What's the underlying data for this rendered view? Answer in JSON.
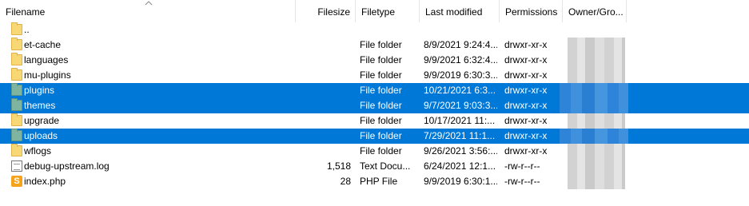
{
  "columns": {
    "filename": "Filename",
    "filesize": "Filesize",
    "filetype": "Filetype",
    "last_modified": "Last modified",
    "permissions": "Permissions",
    "owner_group": "Owner/Gro..."
  },
  "files": [
    {
      "name": "..",
      "size": "",
      "type": "",
      "modified": "",
      "perms": "",
      "icon": "folder-icon",
      "selected": false,
      "owner_blurred": false
    },
    {
      "name": "et-cache",
      "size": "",
      "type": "File folder",
      "modified": "8/9/2021 9:24:4...",
      "perms": "drwxr-xr-x",
      "icon": "folder-icon",
      "selected": false,
      "owner_blurred": true
    },
    {
      "name": "languages",
      "size": "",
      "type": "File folder",
      "modified": "9/9/2021 6:32:4...",
      "perms": "drwxr-xr-x",
      "icon": "folder-icon",
      "selected": false,
      "owner_blurred": true
    },
    {
      "name": "mu-plugins",
      "size": "",
      "type": "File folder",
      "modified": "9/9/2019 6:30:3...",
      "perms": "drwxr-xr-x",
      "icon": "folder-icon",
      "selected": false,
      "owner_blurred": true
    },
    {
      "name": "plugins",
      "size": "",
      "type": "File folder",
      "modified": "10/21/2021 6:3...",
      "perms": "drwxr-xr-x",
      "icon": "folder-icon",
      "selected": true,
      "owner_blurred": true
    },
    {
      "name": "themes",
      "size": "",
      "type": "File folder",
      "modified": "9/7/2021 9:03:3...",
      "perms": "drwxr-xr-x",
      "icon": "folder-icon",
      "selected": true,
      "owner_blurred": true
    },
    {
      "name": "upgrade",
      "size": "",
      "type": "File folder",
      "modified": "10/17/2021 11:...",
      "perms": "drwxr-xr-x",
      "icon": "folder-icon",
      "selected": false,
      "owner_blurred": true
    },
    {
      "name": "uploads",
      "size": "",
      "type": "File folder",
      "modified": "7/29/2021 11:1...",
      "perms": "drwxr-xr-x",
      "icon": "folder-icon",
      "selected": true,
      "owner_blurred": true
    },
    {
      "name": "wflogs",
      "size": "",
      "type": "File folder",
      "modified": "9/26/2021 3:56:...",
      "perms": "drwxr-xr-x",
      "icon": "folder-icon",
      "selected": false,
      "owner_blurred": true
    },
    {
      "name": "debug-upstream.log",
      "size": "1,518",
      "type": "Text Docu...",
      "modified": "6/24/2021 12:1...",
      "perms": "-rw-r--r--",
      "icon": "text-file-icon",
      "selected": false,
      "owner_blurred": true
    },
    {
      "name": "index.php",
      "size": "28",
      "type": "PHP File",
      "modified": "9/9/2019 6:30:1...",
      "perms": "-rw-r--r--",
      "icon": "php-file-icon",
      "selected": false,
      "owner_blurred": true
    }
  ],
  "colors": {
    "selection": "#0078d7",
    "selection_text": "#ffffff",
    "folder": "#f8d775",
    "selected_folder": "#7eb4a0"
  }
}
